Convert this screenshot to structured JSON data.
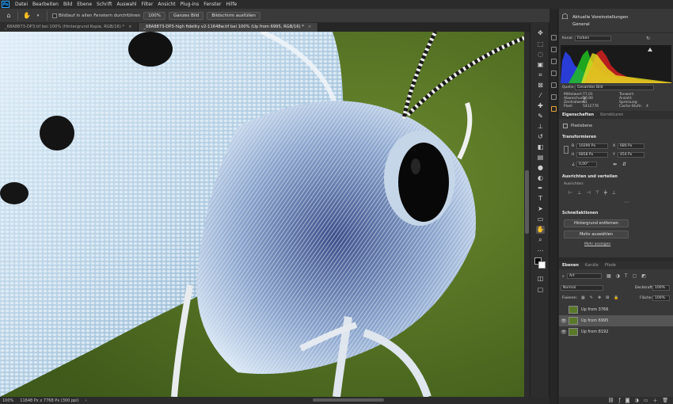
{
  "menubar": {
    "logo": "Ps",
    "items": [
      "Datei",
      "Bearbeiten",
      "Bild",
      "Ebene",
      "Schrift",
      "Auswahl",
      "Filter",
      "Ansicht",
      "Plug-ins",
      "Fenster",
      "Hilfe"
    ]
  },
  "options": {
    "scroll_all_label": "Bildlauf in allen Fenstern durchführen",
    "zoom_100": "100%",
    "fit_screen": "Ganzes Bild",
    "fill_screen": "Bildschirm ausfüllen"
  },
  "tabs": [
    {
      "label": "_68A8873-DP3.tif bei 100% (Hintergrund Kopie, RGB/16) *",
      "active": false
    },
    {
      "label": "_68A8873-DP3-high fidelity v2-11648w.tif bei 100% (Up from 6995, RGB/16) *",
      "active": true
    }
  ],
  "status": {
    "zoom": "100%",
    "doc_info": "11648 Px x 7768 Px (300 ppi)"
  },
  "learn": {
    "title": "Aktuelle Voreinstellungen",
    "subtitle": "General"
  },
  "histogram": {
    "channel_label": "Kanal:",
    "channel_value": "Farben",
    "source_label": "Quelle:",
    "source_value": "Gesamtes Bild",
    "stats_left": [
      {
        "label": "Mittelwert:",
        "value": "77,01"
      },
      {
        "label": "Abweichung:",
        "value": "50,90"
      },
      {
        "label": "Zentralwert:",
        "value": "61"
      },
      {
        "label": "Pixel:",
        "value": "5412776"
      }
    ],
    "stats_right": [
      {
        "label": "Tonwert:",
        "value": ""
      },
      {
        "label": "Anzahl:",
        "value": ""
      },
      {
        "label": "Spreizung:",
        "value": ""
      },
      {
        "label": "Cache-Stufe:",
        "value": "4"
      }
    ]
  },
  "properties": {
    "tabs": [
      "Eigenschaften",
      "Korrekturen"
    ],
    "layer_type": "Pixelebene",
    "transform_title": "Transformieren",
    "w_label": "B",
    "w_value": "10290 Px",
    "x_label": "X",
    "x_value": "680 Px",
    "h_label": "H",
    "h_value": "6858 Px",
    "y_label": "Y",
    "y_value": "454 Px",
    "angle_value": "0,00°",
    "align_title": "Ausrichten und verteilen",
    "align_sub": "Ausrichten:",
    "quick_title": "Schnellaktionen",
    "btn_remove_bg": "Hintergrund entfernen",
    "btn_select_subject": "Motiv auswählen",
    "more_link": "Mehr anzeigen"
  },
  "layers": {
    "tabs": [
      "Ebenen",
      "Kanäle",
      "Pfade"
    ],
    "filter_label": "Art",
    "blend_mode": "Normal",
    "opacity_label": "Deckkraft:",
    "opacity_value": "100%",
    "lock_label": "Fixieren:",
    "fill_label": "Fläche:",
    "fill_value": "100%",
    "items": [
      {
        "name": "Up from 3766",
        "visible": false,
        "selected": false
      },
      {
        "name": "Up from 6995",
        "visible": true,
        "selected": true
      },
      {
        "name": "Up from 8192",
        "visible": true,
        "selected": false
      }
    ]
  },
  "colors": {
    "background_green": "#5c7a2a",
    "wing_blue": "#b8d4e8",
    "panel": "#383838",
    "accent": "#31a8ff"
  }
}
